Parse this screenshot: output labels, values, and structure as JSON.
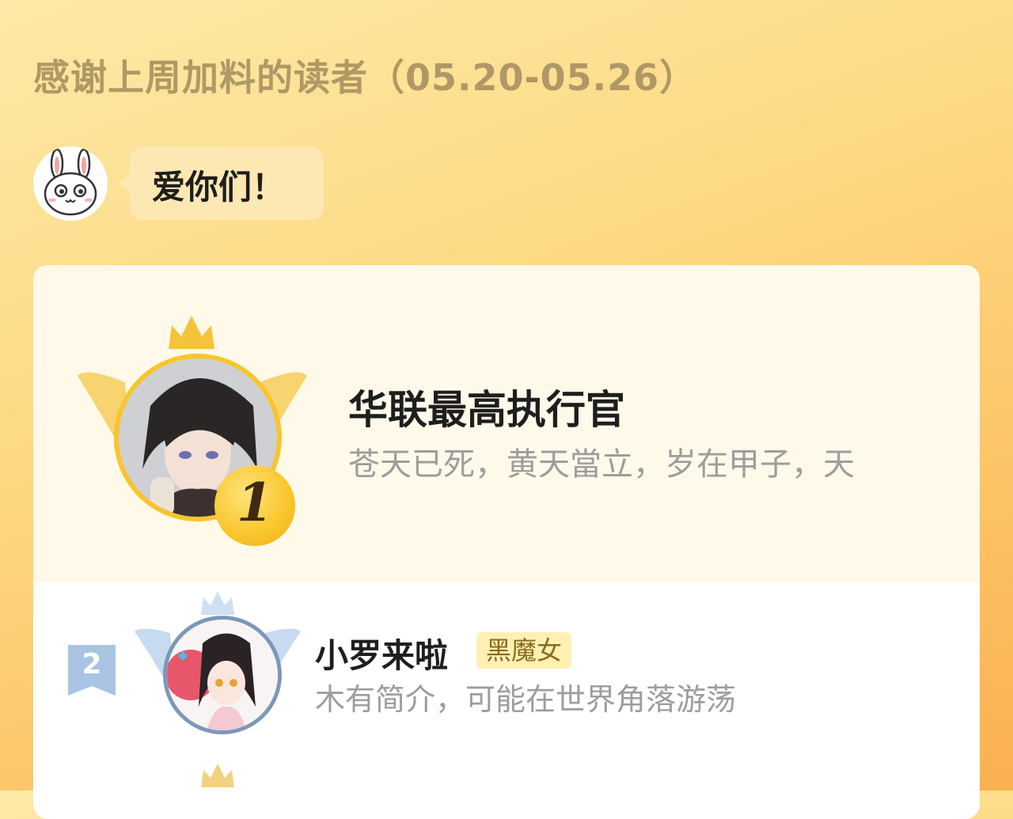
{
  "header": {
    "title": "感谢上周加料的读者（05.20-05.26）"
  },
  "greeting": {
    "mascot_icon": "bunny-mascot-icon",
    "bubble_text": "爱你们！"
  },
  "readers": [
    {
      "rank": "1",
      "name": "华联最高执行官",
      "bio": "苍天已死，黄天當立，岁在甲子，天",
      "badge_color": "#f9c52b"
    },
    {
      "rank": "2",
      "name": "小罗来啦",
      "tag": "黑魔女",
      "bio": "木有简介，可能在世界角落游荡",
      "badge_color": "#a8c4e2"
    }
  ]
}
